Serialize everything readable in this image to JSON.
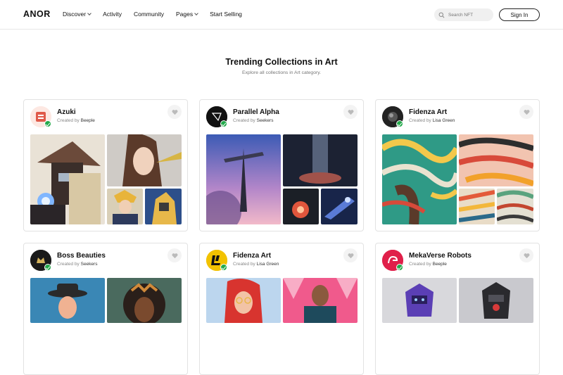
{
  "nav": {
    "logo": "ANOR",
    "items": [
      {
        "label": "Discover",
        "dropdown": true
      },
      {
        "label": "Activity",
        "dropdown": false
      },
      {
        "label": "Community",
        "dropdown": false
      },
      {
        "label": "Pages",
        "dropdown": true
      },
      {
        "label": "Start Selling",
        "dropdown": false
      }
    ],
    "search_placeholder": "Search NFT",
    "signin_label": "Sign In"
  },
  "page": {
    "title": "Trending Collections in Art",
    "subtitle": "Explore all collections in Art category."
  },
  "collections": [
    {
      "name": "Azuki",
      "created_by": "Created by",
      "creator": "Beeple",
      "icon": "azuki-logo-icon",
      "accent": "#e05a4a"
    },
    {
      "name": "Parallel Alpha",
      "created_by": "Created by",
      "creator": "Seekers",
      "icon": "parallel-logo-icon",
      "accent": "#111111"
    },
    {
      "name": "Fidenza Art",
      "created_by": "Created by",
      "creator": "Lisa Green",
      "icon": "fidenza-logo-icon",
      "accent": "#222222"
    },
    {
      "name": "Boss Beauties",
      "created_by": "Created by",
      "creator": "Seekers",
      "icon": "boss-beauties-logo-icon",
      "accent": "#1a1a1a"
    },
    {
      "name": "Fidenza Art",
      "created_by": "Created by",
      "creator": "Lisa Green",
      "icon": "fidenza-yellow-logo-icon",
      "accent": "#f2c200"
    },
    {
      "name": "MekaVerse Robots",
      "created_by": "Created by",
      "creator": "Beeple",
      "icon": "mekaverse-logo-icon",
      "accent": "#e0204a"
    }
  ],
  "colors": {
    "verified": "#22a94a",
    "border": "#e2e2e2"
  }
}
